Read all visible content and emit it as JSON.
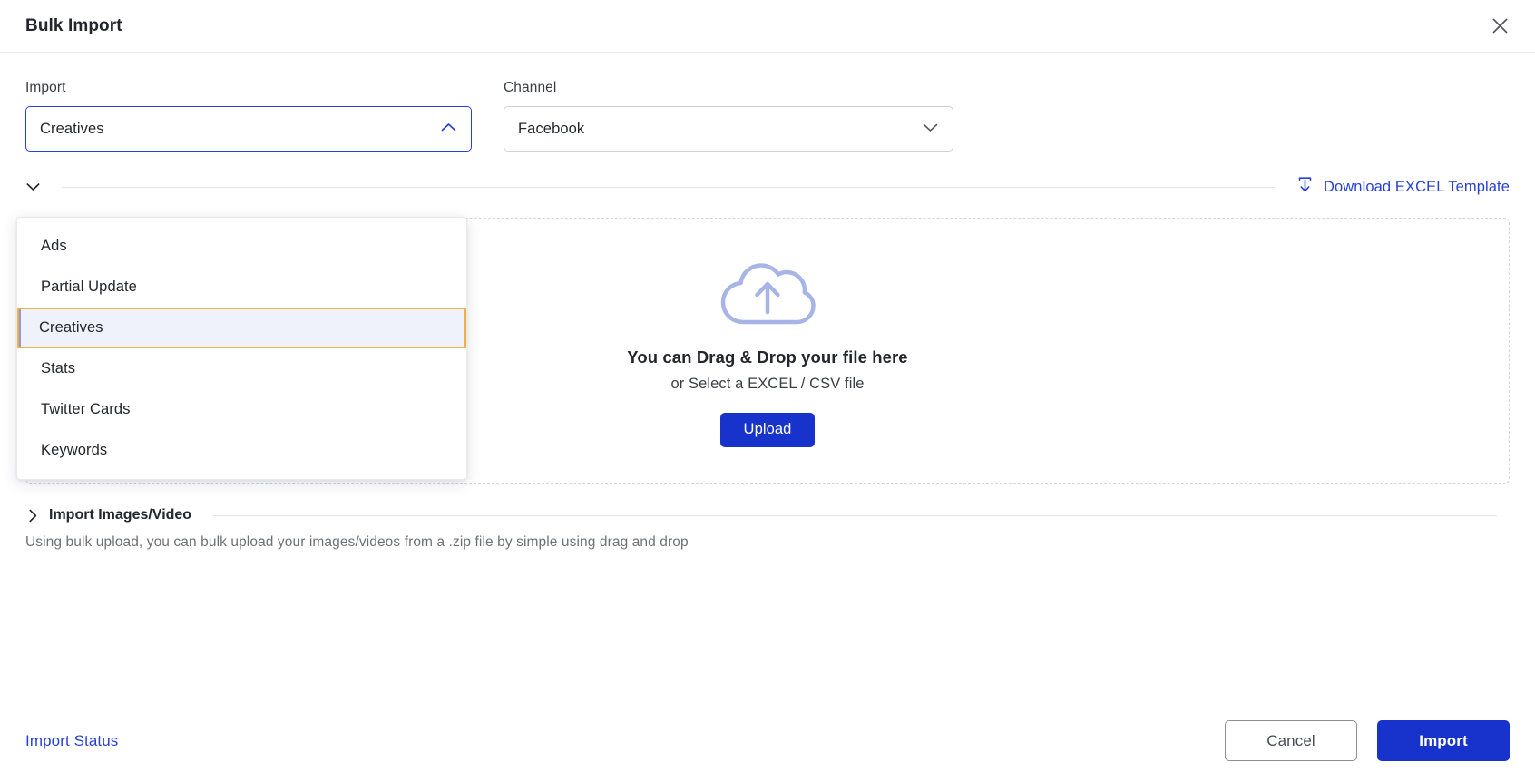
{
  "header": {
    "title": "Bulk Import",
    "close_icon": "close-icon"
  },
  "form": {
    "import": {
      "label": "Import",
      "value": "Creatives",
      "expanded": true,
      "chevron_icon": "chevron-up-icon",
      "options": [
        "Ads",
        "Partial Update",
        "Creatives",
        "Stats",
        "Twitter Cards",
        "Keywords"
      ],
      "selected_index": 2
    },
    "channel": {
      "label": "Channel",
      "value": "Facebook",
      "chevron_icon": "chevron-down-icon"
    }
  },
  "import_file_section": {
    "chevron_icon": "chevron-down-icon",
    "download_link": "Download EXCEL Template",
    "download_icon": "download-icon"
  },
  "dropzone": {
    "cloud_icon": "cloud-upload-icon",
    "title": "You can Drag & Drop your file here",
    "subtitle": "or Select a EXCEL / CSV file",
    "upload_label": "Upload"
  },
  "images_section": {
    "chevron_icon": "chevron-right-icon",
    "title": "Import Images/Video",
    "description": "Using bulk upload, you can bulk upload your images/videos from a .zip file by simple using drag and drop"
  },
  "footer": {
    "status_link": "Import Status",
    "cancel_label": "Cancel",
    "import_label": "Import"
  },
  "colors": {
    "accent_blue": "#1733cc",
    "link_blue": "#2741d6",
    "highlight_border": "#efb145",
    "highlight_bg": "#eff2fa",
    "cloud_blue": "#a7b4e8",
    "border_grey": "#cfd2dc",
    "dashed_grey": "#d3d6dd",
    "muted_text": "#6e7178"
  }
}
